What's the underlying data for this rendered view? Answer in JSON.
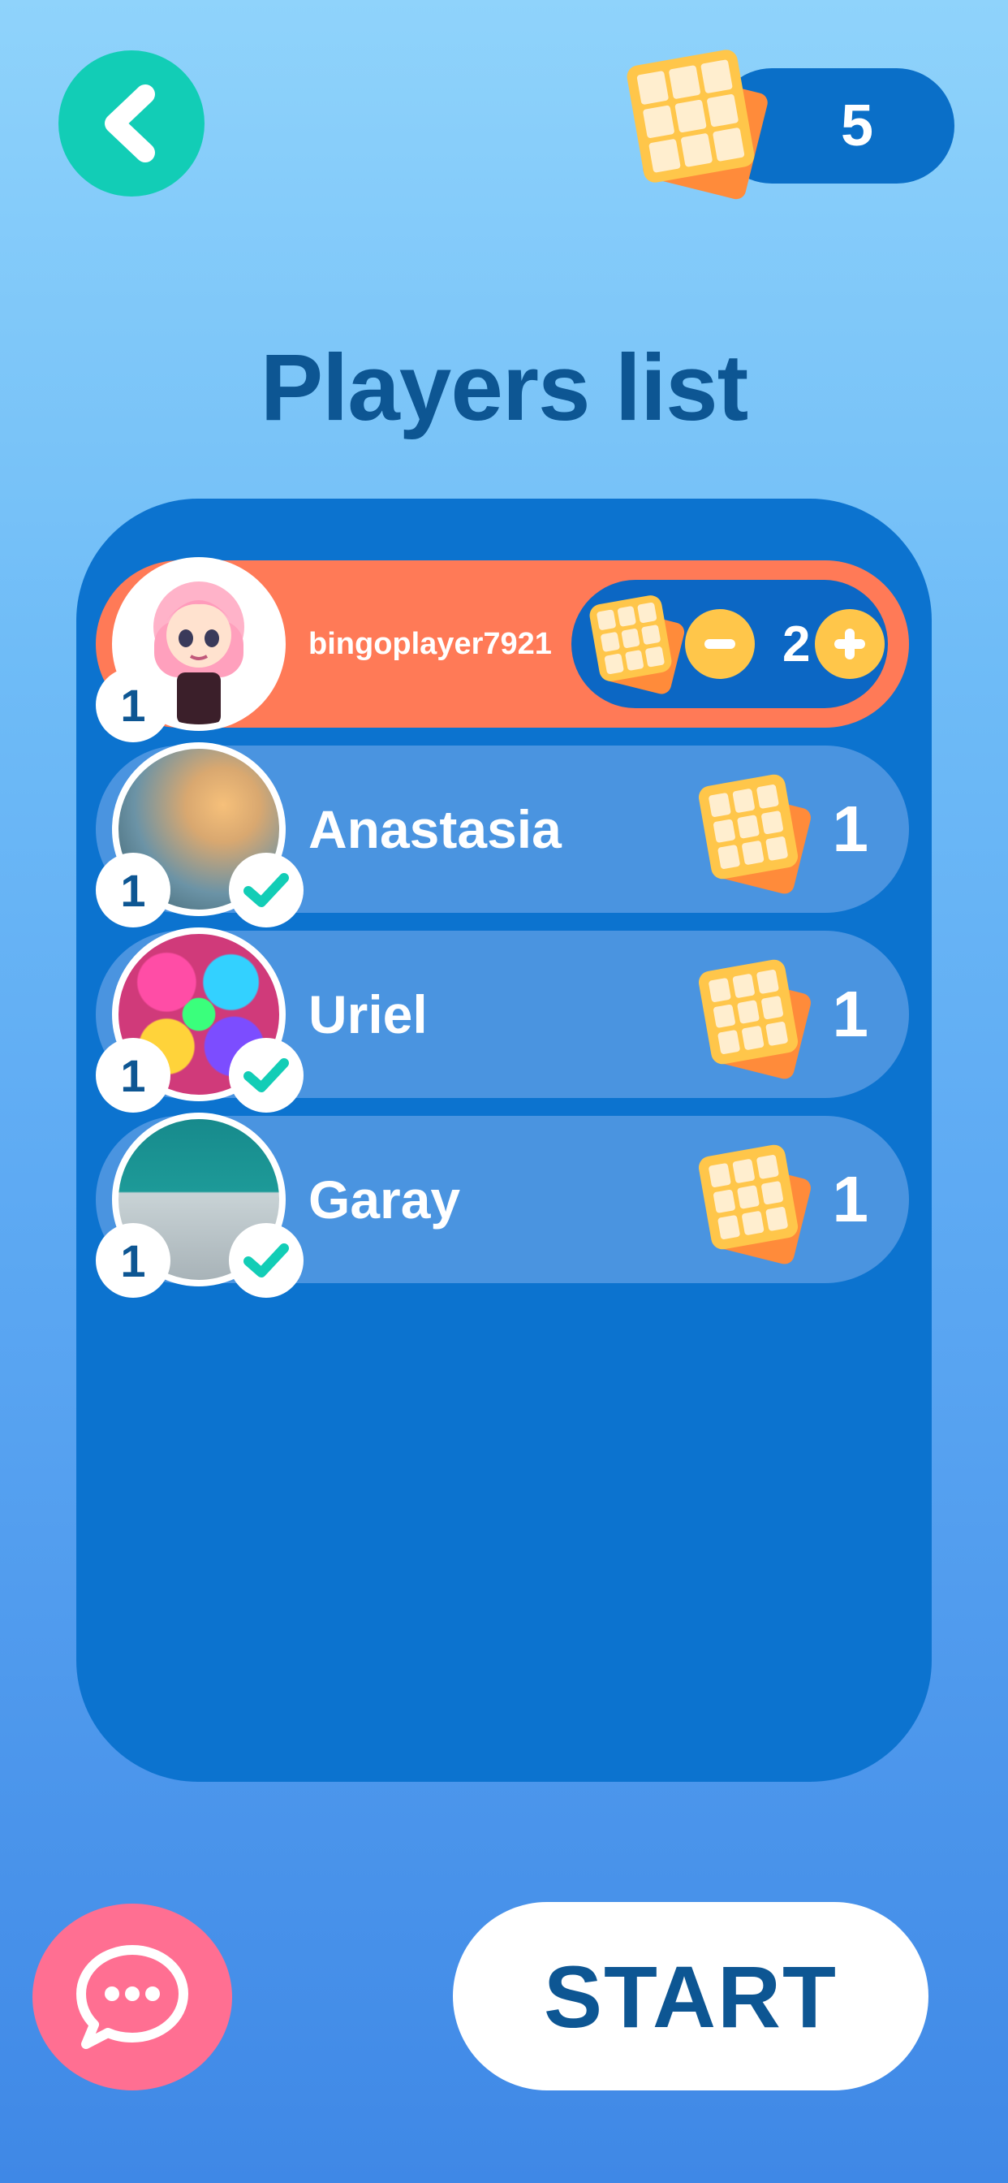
{
  "header": {
    "ticket_count": "5"
  },
  "title": "Players list",
  "players": [
    {
      "name": "bingoplayer7921",
      "rank": "1",
      "cards": "2",
      "is_me": true,
      "ready": false
    },
    {
      "name": "Anastasia",
      "rank": "1",
      "cards": "1",
      "is_me": false,
      "ready": true
    },
    {
      "name": "Uriel",
      "rank": "1",
      "cards": "1",
      "is_me": false,
      "ready": true
    },
    {
      "name": "Garay",
      "rank": "1",
      "cards": "1",
      "is_me": false,
      "ready": true
    }
  ],
  "actions": {
    "start_label": "START"
  },
  "colors": {
    "accent_teal": "#12cdb6",
    "me_row": "#ff7a57",
    "panel": "#0c73cf",
    "card_yellow": "#ffc64a",
    "chat_pink": "#ff6f92"
  },
  "icons": [
    "back-arrow-icon",
    "bingo-card-icon",
    "minus-icon",
    "plus-icon",
    "check-icon",
    "chat-bubble-icon"
  ]
}
